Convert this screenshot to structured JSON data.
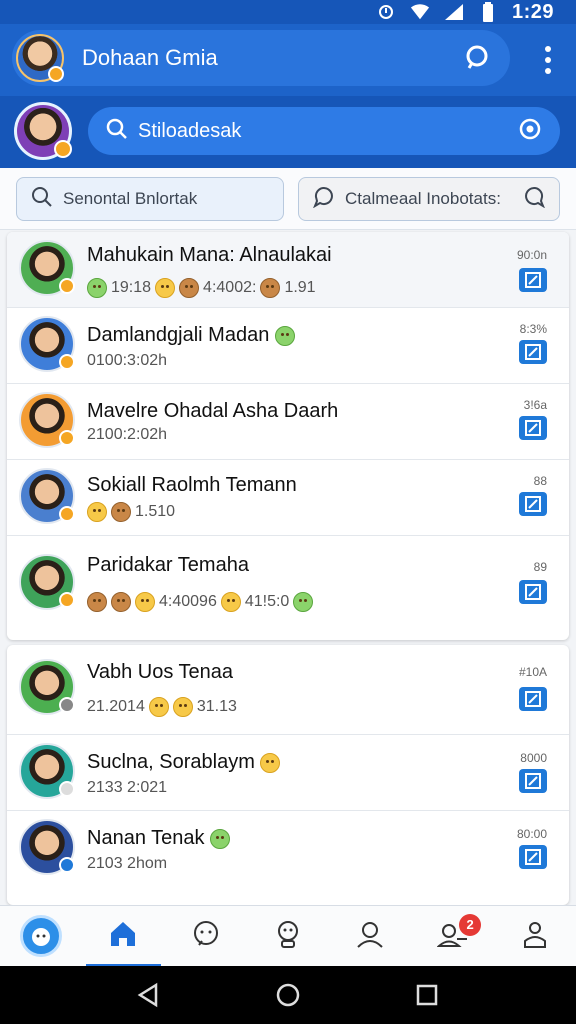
{
  "status_bar": {
    "time": "1:29"
  },
  "header": {
    "title": "Dohaan Gmia"
  },
  "sub_header": {
    "search_label": "Stiloadesak"
  },
  "filters": {
    "left_label": "Senontal Bnlortak",
    "right_label": "Ctalmeaal Inobotats:"
  },
  "chats_primary": [
    {
      "name": "Mahukain Mana: Alnaulakai",
      "sub_time": "19:18",
      "sub_tail": "4:4002:",
      "sub_end": "1.91",
      "meta": "90:0n"
    },
    {
      "name": "Damlandgjali Madan",
      "sub_time": "0100:3:02h",
      "meta": "8:3%"
    },
    {
      "name": "Mavelre Ohadal Asha Daarh",
      "sub_time": "2100:2:02h",
      "meta": "3!6a"
    },
    {
      "name": "Sokiall Raolmh Temann",
      "sub_time": "1.510",
      "meta": "88"
    },
    {
      "name": "Paridakar Temaha",
      "sub_time": "4:40096",
      "sub_tail": "41!5:0",
      "meta": "89"
    }
  ],
  "chats_secondary": [
    {
      "name": "Vabh Uos Tenaa",
      "sub_time": "21.2014",
      "sub_tail": "31.13",
      "meta": "#10A"
    },
    {
      "name": "Suclna, Sorablaym",
      "sub_time": "2133 2:021",
      "meta": "8000"
    },
    {
      "name": "Nanan Tenak",
      "sub_time": "2103 2hom",
      "meta": "80:00"
    }
  ],
  "bottom_nav": {
    "notification_count": "2"
  },
  "colors": {
    "primary": "#1d63c9",
    "accent": "#1f79d8",
    "badge": "#e53935"
  }
}
